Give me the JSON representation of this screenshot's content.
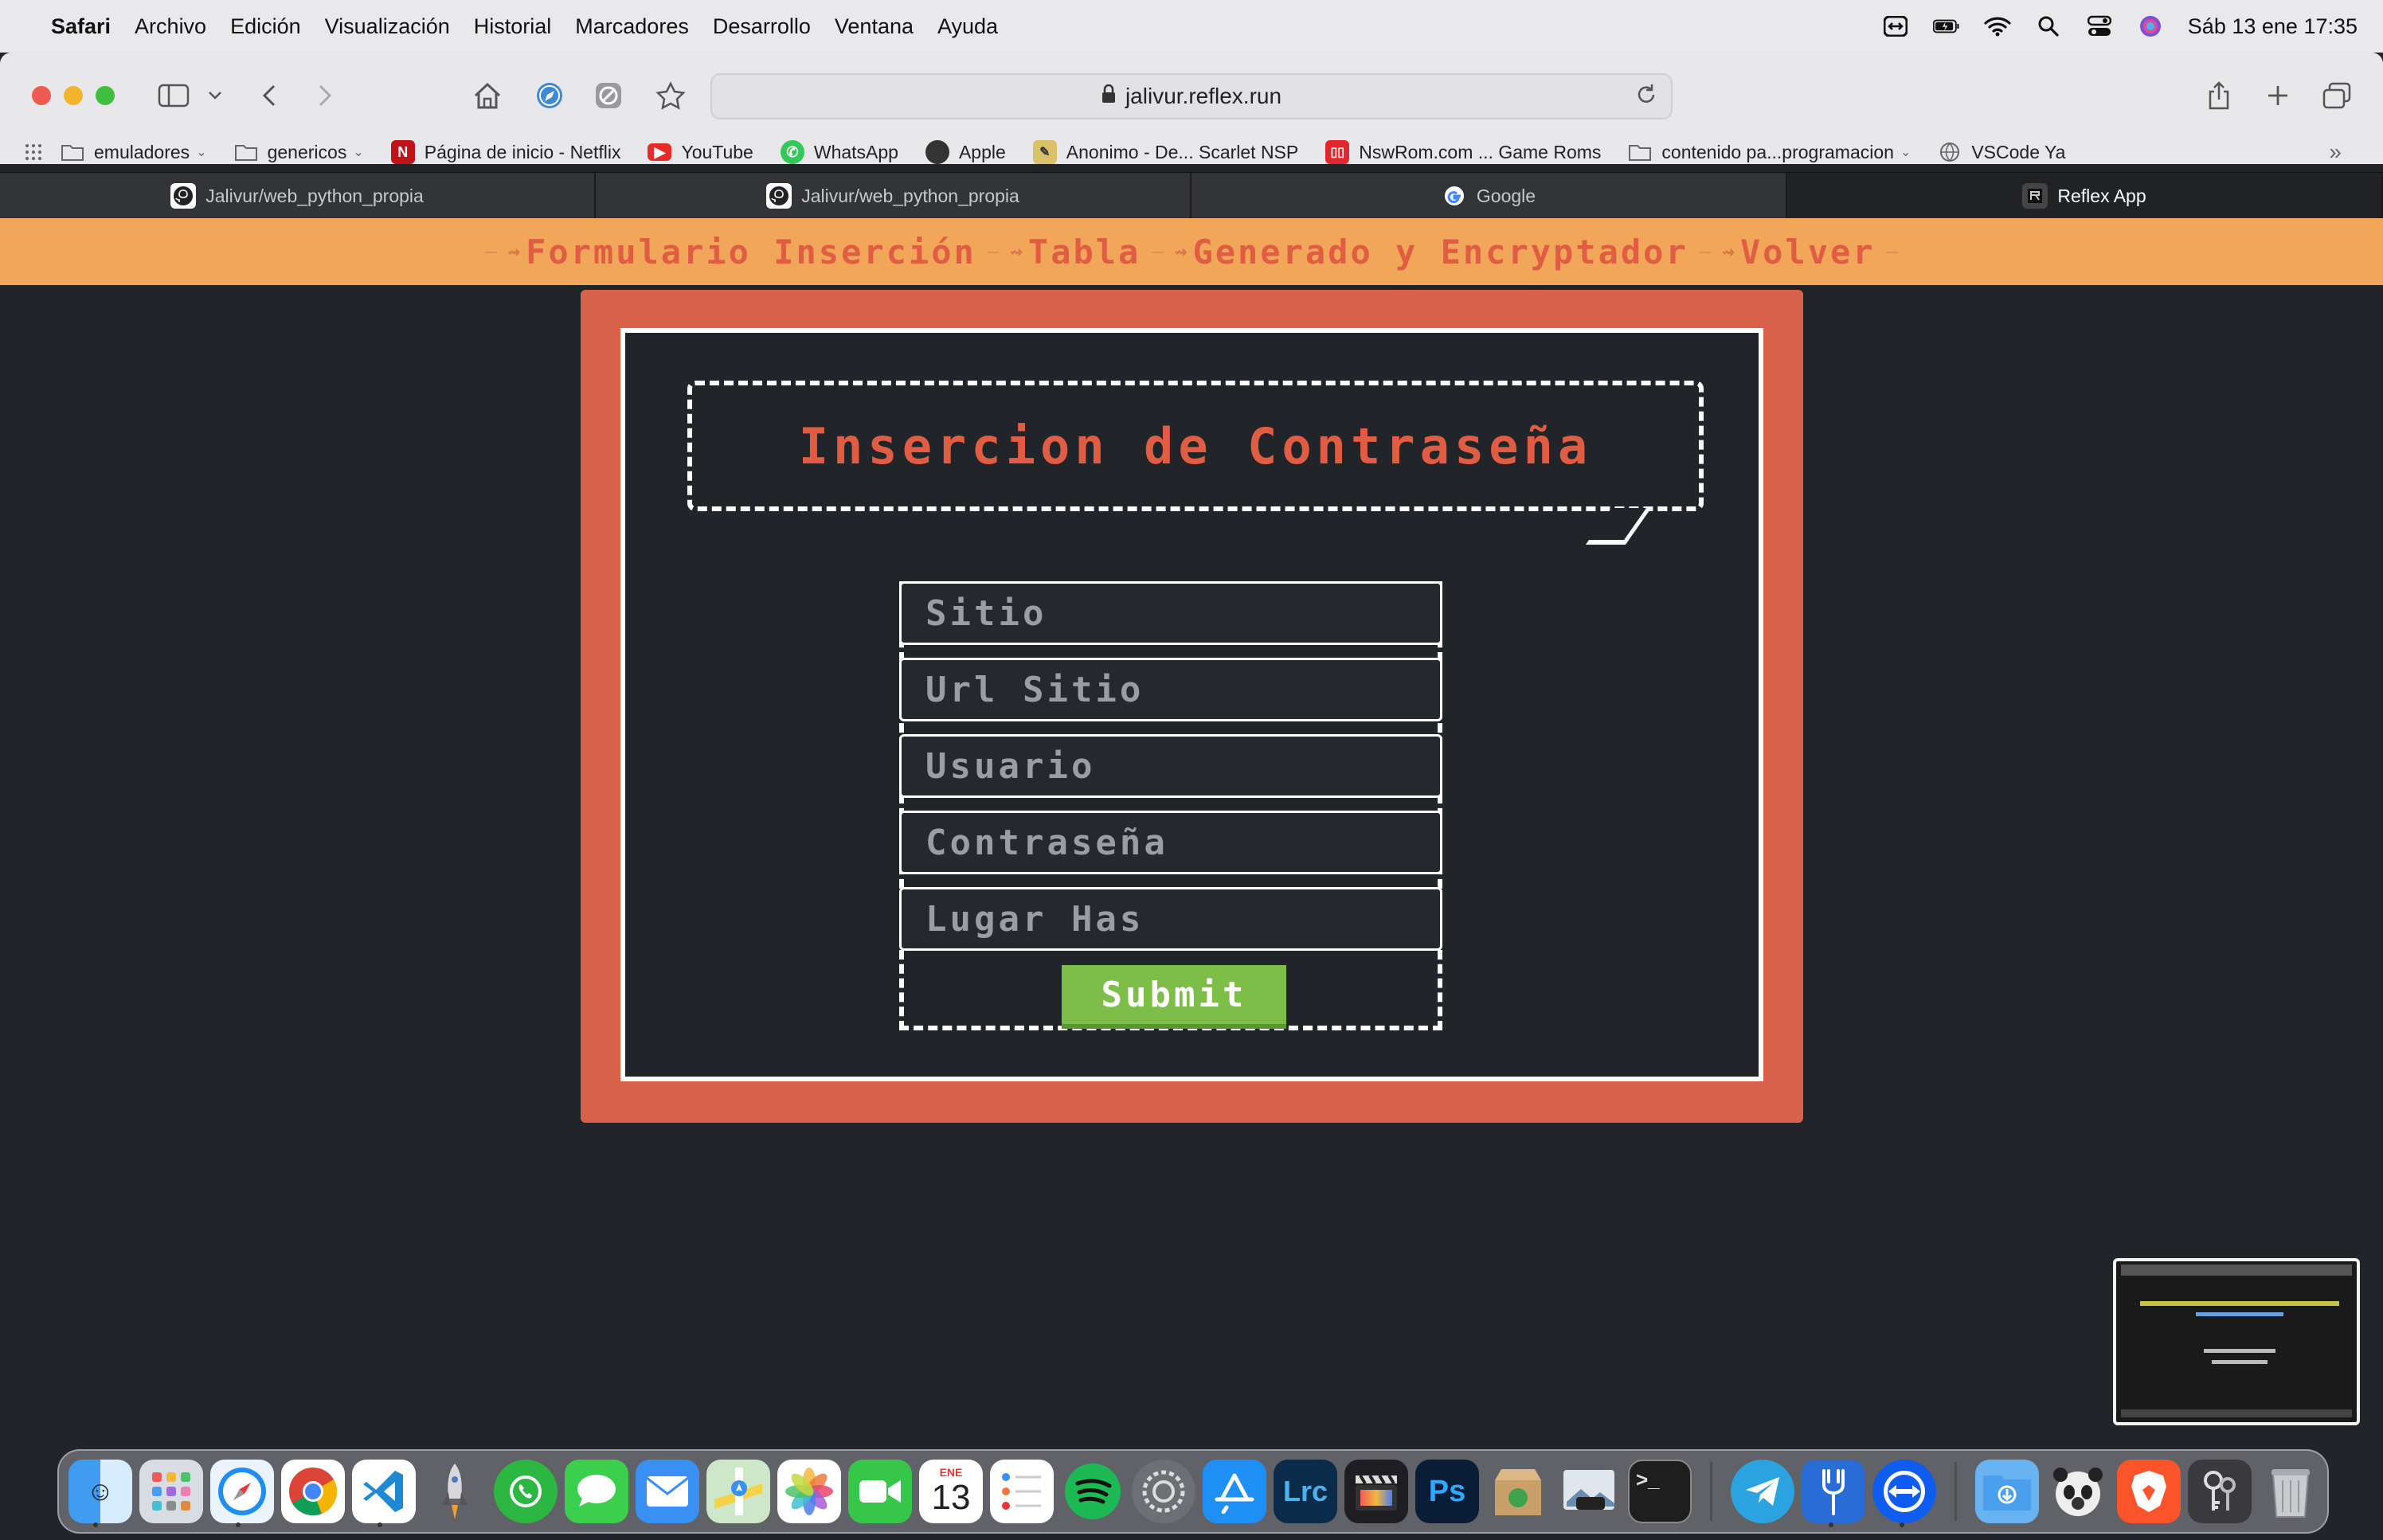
{
  "menubar": {
    "app": "Safari",
    "items": [
      "Archivo",
      "Edición",
      "Visualización",
      "Historial",
      "Marcadores",
      "Desarrollo",
      "Ventana",
      "Ayuda"
    ],
    "clock": "Sáb 13 ene  17:35"
  },
  "browser": {
    "url": "jalivur.reflex.run",
    "bookmarks": [
      {
        "label": "emuladores",
        "icon": "folder-icon",
        "dropdown": true
      },
      {
        "label": "genericos",
        "icon": "folder-icon",
        "dropdown": true
      },
      {
        "label": "Página de inicio - Netflix",
        "icon": "netflix-icon",
        "dropdown": false
      },
      {
        "label": "YouTube",
        "icon": "youtube-icon",
        "dropdown": false
      },
      {
        "label": "WhatsApp",
        "icon": "whatsapp-icon",
        "dropdown": false
      },
      {
        "label": "Apple",
        "icon": "apple-icon",
        "dropdown": false
      },
      {
        "label": "Anonimo - De... Scarlet NSP",
        "icon": "link-icon",
        "dropdown": false
      },
      {
        "label": "NswRom.com ... Game Roms",
        "icon": "switch-icon",
        "dropdown": false
      },
      {
        "label": "contenido pa...programacion",
        "icon": "folder-icon",
        "dropdown": true
      },
      {
        "label": "VSCode Ya",
        "icon": "globe-icon",
        "dropdown": false
      }
    ],
    "tabs": [
      {
        "label": "Jalivur/web_python_propia",
        "icon": "github-icon",
        "active": false
      },
      {
        "label": "Jalivur/web_python_propia",
        "icon": "github-icon",
        "active": false
      },
      {
        "label": "Google",
        "icon": "google-icon",
        "active": false
      },
      {
        "label": "Reflex App",
        "icon": "reflex-icon",
        "active": true
      }
    ]
  },
  "nav": {
    "links": [
      "Formulario Inserción",
      "Tabla",
      "Generado y Encryptador",
      "Volver"
    ]
  },
  "page": {
    "title": "Insercion de Contraseña",
    "fields": [
      {
        "placeholder": "Sitio",
        "value": ""
      },
      {
        "placeholder": "Url Sitio",
        "value": ""
      },
      {
        "placeholder": "Usuario",
        "value": ""
      },
      {
        "placeholder": "Contraseña",
        "value": ""
      },
      {
        "placeholder": "Lugar Has",
        "value": ""
      }
    ],
    "submit_label": "Submit"
  },
  "dock": {
    "calendar_month": "ENE",
    "calendar_day": "13",
    "apps": [
      "finder",
      "launchpad",
      "safari",
      "chrome",
      "vscode",
      "rocket",
      "whatsapp",
      "messages",
      "mail",
      "maps",
      "photos",
      "facetime",
      "calendar",
      "reminders",
      "spotify",
      "system-settings",
      "app-store",
      "lightroom",
      "final-cut",
      "photoshop",
      "archive-utility",
      "preview",
      "terminal",
      "telegram",
      "fork",
      "teamviewer",
      "downloads",
      "panda",
      "brave",
      "keychain",
      "trash"
    ]
  },
  "colors": {
    "page_bg": "#212429",
    "nav_bg": "#f1a659",
    "accent": "#e05d44",
    "frame": "#d9614a",
    "submit": "#7dbe49"
  }
}
